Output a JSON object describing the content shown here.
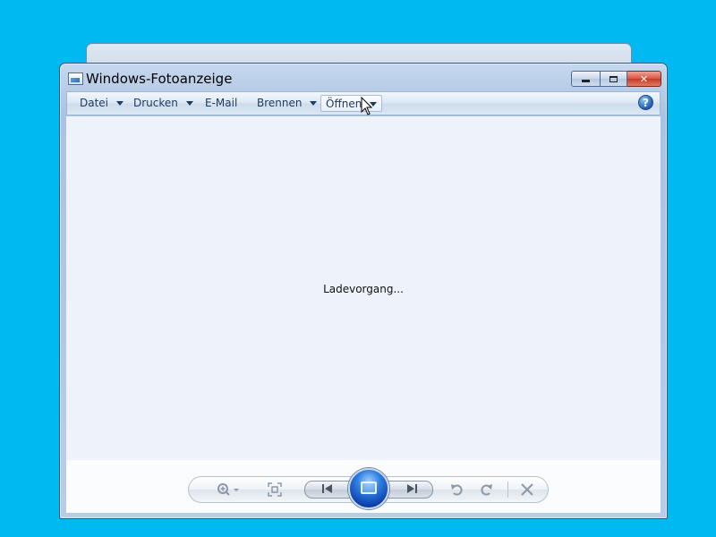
{
  "window": {
    "title": "Windows-Fotoanzeige"
  },
  "menubar": {
    "items": [
      {
        "label": "Datei",
        "has_dropdown": true
      },
      {
        "label": "Drucken",
        "has_dropdown": true
      },
      {
        "label": "E-Mail",
        "has_dropdown": false
      },
      {
        "label": "Brennen",
        "has_dropdown": true
      },
      {
        "label": "Öffnen",
        "has_dropdown": true,
        "state": "hover"
      }
    ],
    "help_icon": "?"
  },
  "content": {
    "status_text": "Ladevorgang..."
  },
  "controls": {
    "icons": [
      "zoom-icon",
      "actual-size-icon",
      "previous-icon",
      "slideshow-icon",
      "next-icon",
      "rotate-left-icon",
      "rotate-right-icon",
      "delete-icon"
    ]
  },
  "colors": {
    "desktop": "#00b9f0",
    "content_bg": "#eef2fa",
    "close_button": "#c23b26",
    "play_button": "#2f7fe0"
  }
}
